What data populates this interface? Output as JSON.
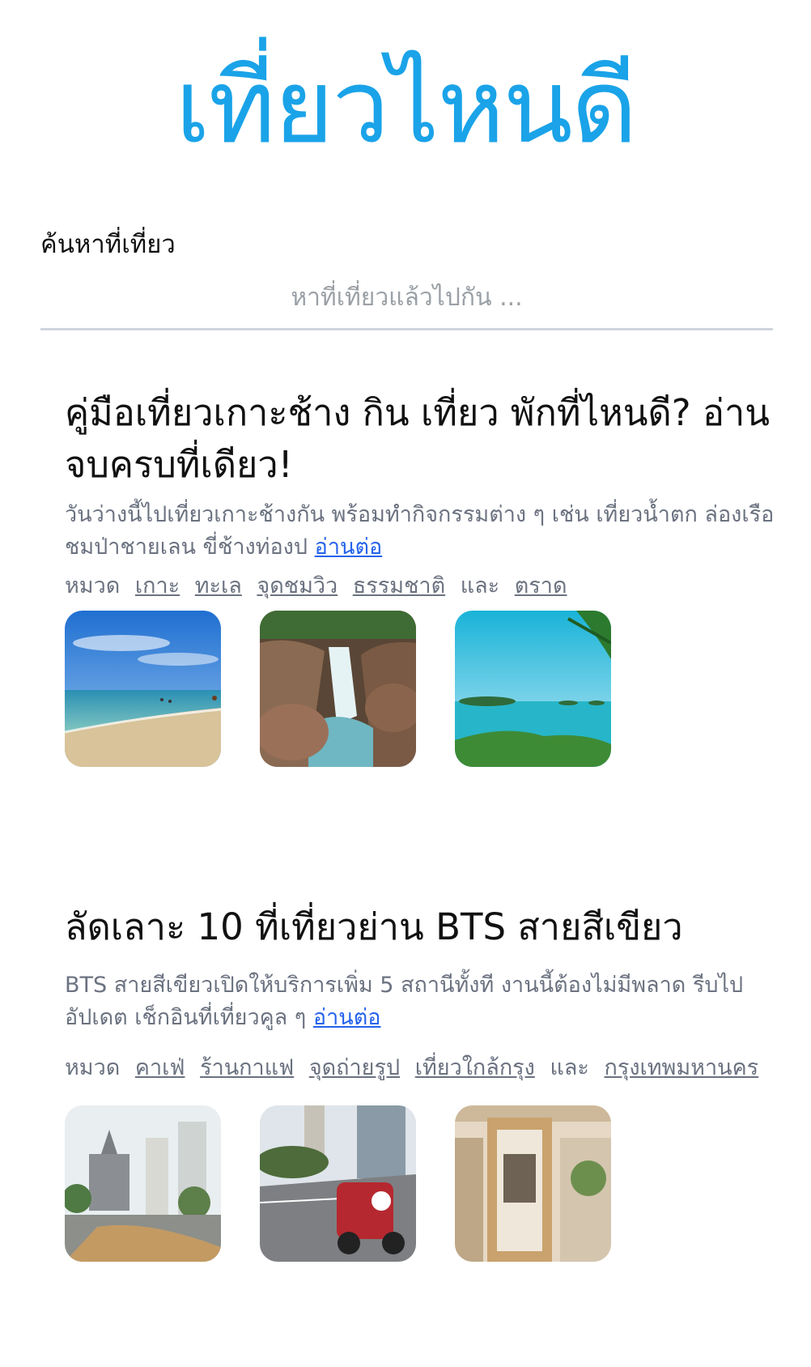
{
  "app_title": "เที่ยวไหนดี",
  "search": {
    "label": "ค้นหาที่เที่ยว",
    "placeholder": "หาที่เที่ยวแล้วไปกัน ..."
  },
  "articles": [
    {
      "title": "คู่มือเที่ยวเกาะช้าง กิน เที่ยว พักที่ไหนดี? อ่านจบครบที่เดียว!",
      "description": "วันว่างนี้ไปเที่ยวเกาะช้างกัน พร้อมทำกิจกรรมต่าง ๆ เช่น เที่ยวน้ำตก ล่องเรือชมป่าชายเลน ขี่ช้างท่องป",
      "read_more": "อ่านต่อ",
      "category_label": "หมวด",
      "categories": [
        "เกาะ",
        "ทะเล",
        "จุดชมวิว",
        "ธรรมชาติ"
      ],
      "and_label": "และ",
      "last_category": "ตราด",
      "images": [
        "beach-photo",
        "waterfall-photo",
        "island-viewpoint-photo"
      ]
    },
    {
      "title": "ลัดเลาะ 10 ที่เที่ยวย่าน BTS สายสีเขียว",
      "description": "BTS สายสีเขียวเปิดให้บริการเพิ่ม 5 สถานีทั้งที งานนี้ต้องไม่มีพลาด รีบไปอัปเดต เช็กอินที่เที่ยวคูล ๆ",
      "read_more": "อ่านต่อ",
      "category_label": "หมวด",
      "categories": [
        "คาเฟ่",
        "ร้านกาแฟ",
        "จุดถ่ายรูป",
        "เที่ยวใกล้กรุง"
      ],
      "and_label": "และ",
      "last_category": "กรุงเทพมหานคร",
      "images": [
        "castle-park-photo",
        "go-kart-photo",
        "cafe-entrance-photo"
      ]
    }
  ]
}
